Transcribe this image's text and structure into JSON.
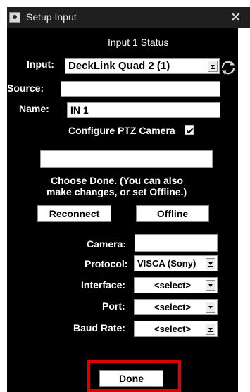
{
  "window": {
    "title": "Setup Input"
  },
  "status": {
    "heading": "Input 1 Status"
  },
  "input": {
    "label": "Input:",
    "value": "DeckLink Quad 2 (1)"
  },
  "source": {
    "label": "Source:",
    "value": ""
  },
  "name": {
    "label": "Name:",
    "value": "IN 1"
  },
  "ptz": {
    "label": "Configure PTZ Camera",
    "checked": true
  },
  "message": {
    "box_value": "",
    "line1": "Choose Done. (You can also",
    "line2": "make changes, or set Offline.)"
  },
  "actions": {
    "reconnect": "Reconnect",
    "offline": "Offline",
    "done": "Done"
  },
  "camera": {
    "camera_label": "Camera:",
    "camera_value": "",
    "protocol_label": "Protocol:",
    "protocol_value": "VISCA (Sony)",
    "interface_label": "Interface:",
    "interface_value": "<select>",
    "port_label": "Port:",
    "port_value": "<select>",
    "baud_label": "Baud Rate:",
    "baud_value": "<select>"
  },
  "colors": {
    "panel": "#000000",
    "titlebar": "#1f1f1f",
    "highlight": "#e00000"
  },
  "icons": [
    "app-icon",
    "close-icon",
    "refresh-icon",
    "checkbox-check-icon",
    "dropdown-arrow-icon"
  ]
}
